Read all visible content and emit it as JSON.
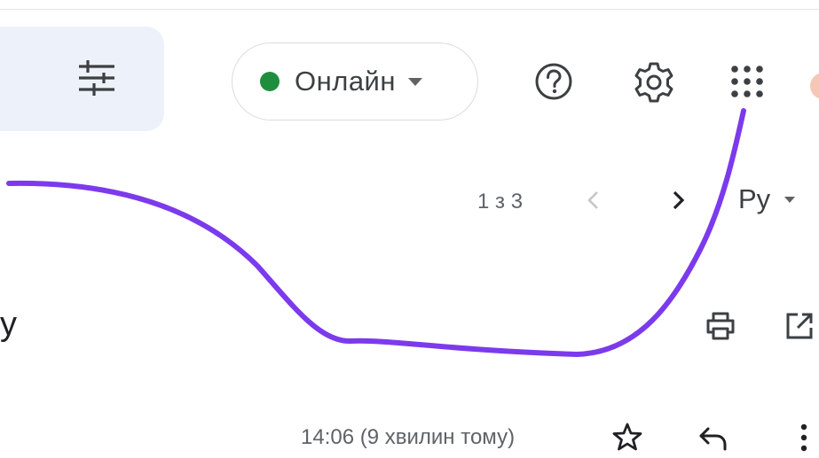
{
  "header": {
    "status": {
      "label": "Онлайн",
      "dot_color": "#1e8e3e"
    }
  },
  "toolbar": {
    "pager_text": "1 з 3",
    "input_tool_label": "Ру"
  },
  "message": {
    "subject_tail": "у",
    "time_text": "14:06 (9 хвилин тому)"
  },
  "annotation": {
    "color": "#7c3aed"
  }
}
